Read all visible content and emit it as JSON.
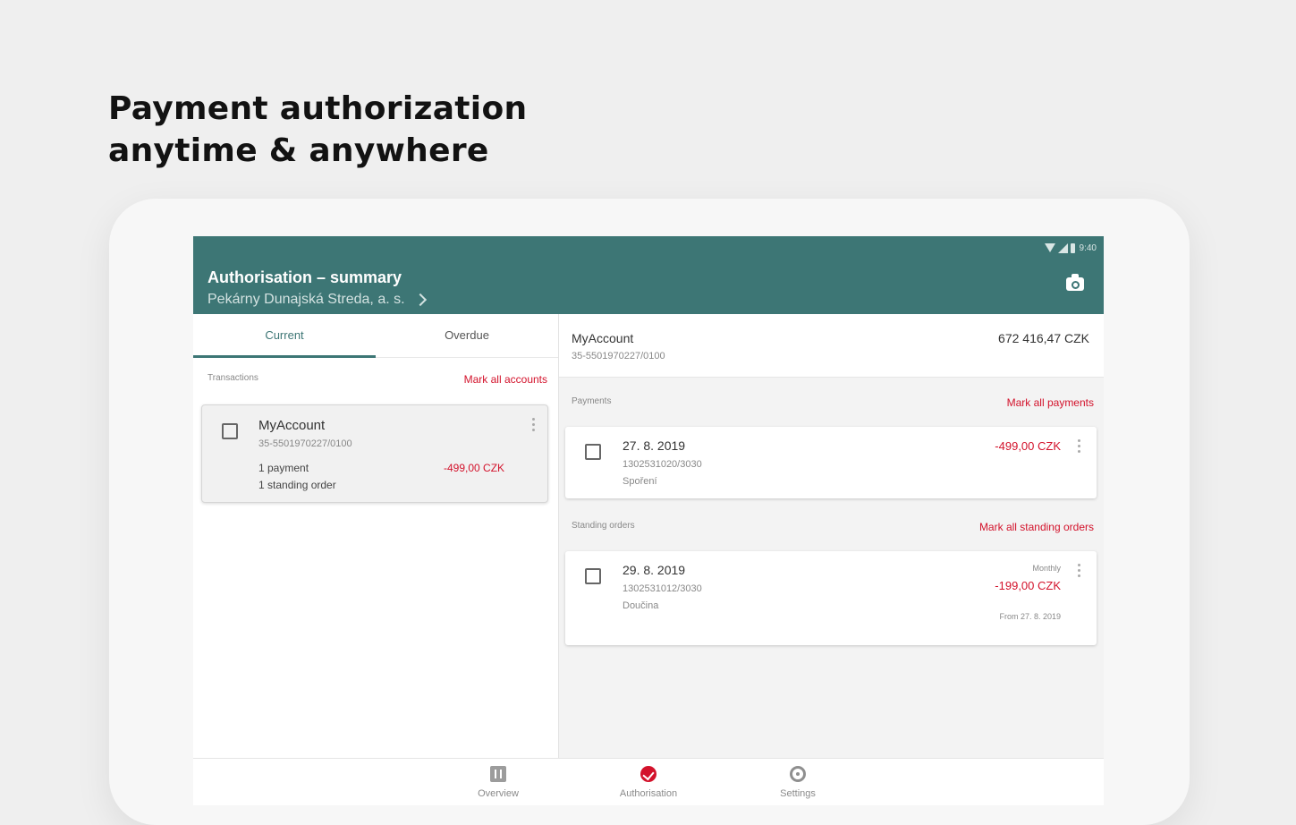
{
  "headline": {
    "line1": "Payment authorization",
    "line2": "anytime & anywhere"
  },
  "status_bar": {
    "time": "9:40"
  },
  "app_bar": {
    "title": "Authorisation – summary",
    "subtitle": "Pekárny Dunajská Streda, a. s."
  },
  "tabs": [
    {
      "label": "Current",
      "selected": true
    },
    {
      "label": "Overdue",
      "selected": false
    }
  ],
  "left_panel": {
    "section_label": "Transactions",
    "mark_all": "Mark all accounts",
    "account": {
      "name": "MyAccount",
      "number": "35-5501970227/0100",
      "payments": "1 payment",
      "standing_orders": "1 standing order",
      "amount": "-499,00 CZK"
    }
  },
  "right_panel": {
    "account_name": "MyAccount",
    "account_number": "35-5501970227/0100",
    "balance": "672 416,47 CZK",
    "payments": {
      "label": "Payments",
      "mark_all": "Mark all payments",
      "items": [
        {
          "date": "27. 8. 2019",
          "account": "1302531020/3030",
          "note": "Spoření",
          "amount": "-499,00 CZK"
        }
      ]
    },
    "standing_orders": {
      "label": "Standing orders",
      "mark_all": "Mark all standing orders",
      "items": [
        {
          "date": "29. 8. 2019",
          "account": "1302531012/3030",
          "note": "Doučina",
          "frequency": "Monthly",
          "amount": "-199,00 CZK",
          "from": "From 27. 8. 2019"
        }
      ]
    }
  },
  "bottom_nav": [
    {
      "label": "Overview",
      "icon": "document-icon"
    },
    {
      "label": "Authorisation",
      "icon": "check-circle-icon",
      "active": true
    },
    {
      "label": "Settings",
      "icon": "gear-icon"
    }
  ],
  "colors": {
    "primary": "#3d7675",
    "accent_red": "#d3122b"
  }
}
